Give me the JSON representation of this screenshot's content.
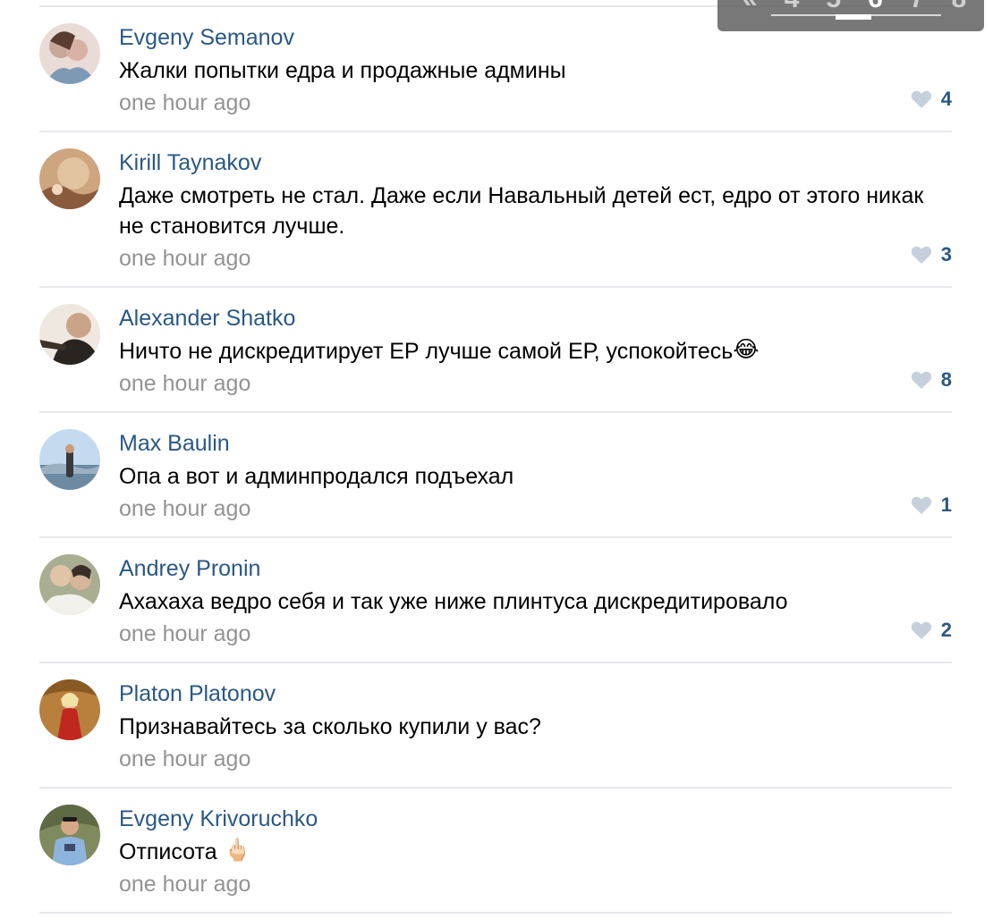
{
  "pager": {
    "prev_icon": "double-chevron-left",
    "next_icon": "double-chevron-right",
    "pages": [
      "4",
      "5",
      "6",
      "7",
      "8"
    ],
    "current": "6"
  },
  "comments": [
    {
      "author": "Evgeny Semanov",
      "text": "Жалки попытки едра и продажные админы",
      "time": "one hour ago",
      "likes": "4",
      "avatar_colors": [
        "#c9a69a",
        "#7d9ab5"
      ]
    },
    {
      "author": "Kirill Taynakov",
      "text": "Даже смотреть не стал. Даже если Навальный детей ест, едро от этого никак не становится лучше.",
      "time": "one hour ago",
      "likes": "3",
      "avatar_colors": [
        "#d1a77a",
        "#8a5a3c"
      ]
    },
    {
      "author": "Alexander Shatko",
      "text": "Ничто не дискредитирует ЕР лучше самой ЕР, успокойтесь",
      "emoji": "😂",
      "time": "one hour ago",
      "likes": "8",
      "avatar_colors": [
        "#e8e0d8",
        "#2a2420"
      ]
    },
    {
      "author": "Max Baulin",
      "text": "Опа а вот и админпродался подъехал",
      "time": "one hour ago",
      "likes": "1",
      "avatar_colors": [
        "#bcd3e8",
        "#4f6f8a"
      ]
    },
    {
      "author": "Andrey Pronin",
      "text": "Ахахаха ведро себя и так уже ниже плинтуса дискредитировало",
      "time": "one hour ago",
      "likes": "2",
      "avatar_colors": [
        "#9da486",
        "#5a5e4a"
      ]
    },
    {
      "author": "Platon Platonov",
      "text": "Признавайтесь за сколько купили у вас?",
      "time": "one hour ago",
      "likes": "",
      "avatar_colors": [
        "#b8803c",
        "#c0281f"
      ]
    },
    {
      "author": "Evgeny Krivoruchko",
      "text": "Отписота",
      "emoji": "🖕🏻",
      "time": "one hour ago",
      "likes": "",
      "avatar_colors": [
        "#7f8a5e",
        "#3d4a6a"
      ]
    }
  ],
  "colors": {
    "author": "#2a5885",
    "time": "#939393",
    "heart": "#c5d0dc",
    "divider": "#e7e8ec"
  }
}
